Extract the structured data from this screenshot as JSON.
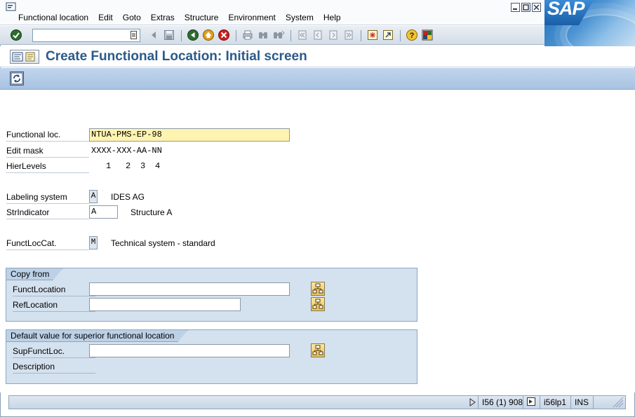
{
  "menu": {
    "items": [
      "Functional location",
      "Edit",
      "Goto",
      "Extras",
      "Structure",
      "Environment",
      "System",
      "Help"
    ]
  },
  "brand": {
    "logo_text": "SAP",
    "color": "#1d6fb8"
  },
  "toolbar": {
    "command_value": "",
    "icons": [
      "enter-icon",
      "back-arrow-icon",
      "save-icon",
      "back-icon",
      "exit-icon",
      "cancel-icon",
      "print-icon",
      "find-icon",
      "find-next-icon",
      "first-page-icon",
      "prev-page-icon",
      "next-page-icon",
      "last-page-icon",
      "new-session-icon",
      "shortcut-icon",
      "help-icon",
      "layout-icon"
    ]
  },
  "title": {
    "text": "Create Functional Location: Initial screen",
    "color": "#2a5a8a"
  },
  "form": {
    "functional_loc": {
      "label": "Functional loc.",
      "value": "NTUA-PMS-EP-98"
    },
    "edit_mask": {
      "label": "Edit mask",
      "value": "XXXX-XXX-AA-NN"
    },
    "hier_levels": {
      "label": "HierLevels",
      "levels": [
        "1",
        "2",
        "3",
        "4"
      ]
    },
    "labeling_system": {
      "label": "Labeling system",
      "value": "A",
      "text": "IDES AG"
    },
    "str_indicator": {
      "label": "StrIndicator",
      "value": "A",
      "text": "Structure A"
    },
    "funct_loc_cat": {
      "label": "FunctLocCat.",
      "value": "M",
      "text": "Technical system - standard"
    }
  },
  "copy_from": {
    "title": "Copy from",
    "funct_location": {
      "label": "FunctLocation",
      "value": ""
    },
    "ref_location": {
      "label": "RefLocation",
      "value": ""
    }
  },
  "default_superior": {
    "title": "Default value for superior functional location",
    "sup_funct_loc": {
      "label": "SupFunctLoc.",
      "value": ""
    },
    "description": {
      "label": "Description",
      "value": ""
    }
  },
  "status": {
    "system": "I56 (1) 908",
    "server": "i56lp1",
    "mode": "INS"
  }
}
